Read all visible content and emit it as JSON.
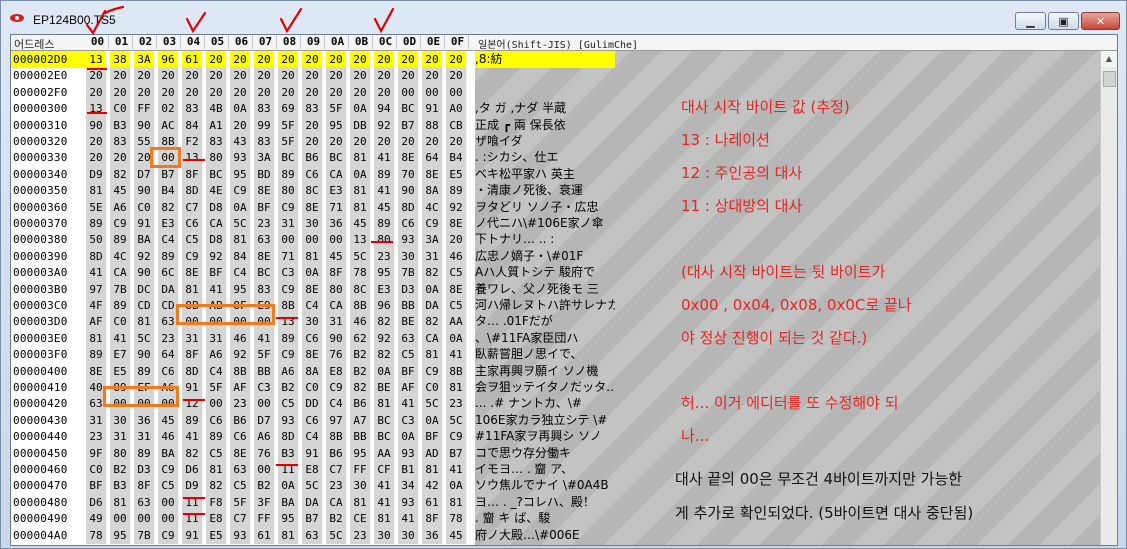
{
  "window": {
    "title": "EP124B00.TS5"
  },
  "header": {
    "offset_label": "어드레스",
    "columns": [
      "00",
      "01",
      "02",
      "03",
      "04",
      "05",
      "06",
      "07",
      "08",
      "09",
      "0A",
      "0B",
      "0C",
      "0D",
      "0E",
      "0F"
    ],
    "encoding_label": "일본어(Shift-JIS) [GulimChe]"
  },
  "rows": [
    {
      "addr": "000002D0",
      "bytes": [
        "13",
        "38",
        "3A",
        "96",
        "61",
        "20",
        "20",
        "20",
        "20",
        "20",
        "20",
        "20",
        "20",
        "20",
        "20",
        "20"
      ],
      "text": " ,8:紡",
      "highlight": true
    },
    {
      "addr": "000002E0",
      "bytes": [
        "20",
        "20",
        "20",
        "20",
        "20",
        "20",
        "20",
        "20",
        "20",
        "20",
        "20",
        "20",
        "20",
        "20",
        "20",
        "20"
      ],
      "text": ""
    },
    {
      "addr": "000002F0",
      "bytes": [
        "20",
        "20",
        "20",
        "20",
        "20",
        "20",
        "20",
        "20",
        "20",
        "20",
        "20",
        "20",
        "20",
        "00",
        "00",
        "00"
      ],
      "text": ""
    },
    {
      "addr": "00000300",
      "bytes": [
        "13",
        "C0",
        "FF",
        "02",
        "83",
        "4B",
        "0A",
        "83",
        "69",
        "83",
        "5F",
        "0A",
        "94",
        "BC",
        "91",
        "A0"
      ],
      "text": " ,タ  ガ ,ナダ 半蔵"
    },
    {
      "addr": "00000310",
      "bytes": [
        "90",
        "B3",
        "90",
        "AC",
        "84",
        "A1",
        "20",
        "99",
        "5F",
        "20",
        "95",
        "DB",
        "92",
        "B7",
        "88",
        "CB"
      ],
      "text": "正成 ┏ 兩  保長依"
    },
    {
      "addr": "00000320",
      "bytes": [
        "20",
        "83",
        "55",
        "8B",
        "F2",
        "83",
        "43",
        "83",
        "5F",
        "20",
        "20",
        "20",
        "20",
        "20",
        "20",
        "20"
      ],
      "text": "  ザ喰イダ"
    },
    {
      "addr": "00000330",
      "bytes": [
        "20",
        "20",
        "20",
        "00",
        "13",
        "80",
        "93",
        "3A",
        "BC",
        "B6",
        "BC",
        "81",
        "41",
        "8E",
        "64",
        "B4"
      ],
      "text": "      .  :シカシ、仕エ"
    },
    {
      "addr": "00000340",
      "bytes": [
        "D9",
        "82",
        "D7",
        "B7",
        "8F",
        "BC",
        "95",
        "BD",
        "89",
        "C6",
        "CA",
        "0A",
        "89",
        "70",
        "8E",
        "E5"
      ],
      "text": "   ベキ松平家ハ 英主"
    },
    {
      "addr": "00000350",
      "bytes": [
        "81",
        "45",
        "90",
        "B4",
        "8D",
        "4E",
        "C9",
        "8E",
        "80",
        "8C",
        "E3",
        "81",
        "41",
        "90",
        "8A",
        "89"
      ],
      "text": "・清康ノ死後、衰運"
    },
    {
      "addr": "00000360",
      "bytes": [
        "5E",
        "A6",
        "C0",
        "82",
        "C7",
        "D8",
        "0A",
        "BF",
        "C9",
        "8E",
        "71",
        "81",
        "45",
        "8D",
        "4C",
        "92"
      ],
      "text": "  ヲタどリ ソノ子・広忠"
    },
    {
      "addr": "00000370",
      "bytes": [
        "89",
        "C9",
        "91",
        "E3",
        "C6",
        "CA",
        "5C",
        "23",
        "31",
        "30",
        "36",
        "45",
        "89",
        "C6",
        "C9",
        "8E"
      ],
      "text": "  ノ代ニハ\\#106E家ノ傘"
    },
    {
      "addr": "00000380",
      "bytes": [
        "50",
        "89",
        "BA",
        "C4",
        "C5",
        "D8",
        "81",
        "63",
        "00",
        "00",
        "00",
        "13",
        "80",
        "93",
        "3A",
        "20"
      ],
      "text": "   下トナリ…  ..   :"
    },
    {
      "addr": "00000390",
      "bytes": [
        "8D",
        "4C",
        "92",
        "89",
        "C9",
        "92",
        "84",
        "8E",
        "71",
        "81",
        "45",
        "5C",
        "23",
        "30",
        "31",
        "46"
      ],
      "text": "広忠ノ嫡子・\\#01F"
    },
    {
      "addr": "000003A0",
      "bytes": [
        "41",
        "CA",
        "90",
        "6C",
        "8E",
        "BF",
        "C4",
        "BC",
        "C3",
        "0A",
        "8F",
        "78",
        "95",
        "7B",
        "82",
        "C5"
      ],
      "text": "Aハ人質トシテ 駿府で"
    },
    {
      "addr": "000003B0",
      "bytes": [
        "97",
        "7B",
        "DC",
        "DA",
        "81",
        "41",
        "95",
        "83",
        "C9",
        "8E",
        "80",
        "8C",
        "E3",
        "D3",
        "0A",
        "8E"
      ],
      "text": "養ワレ、父ノ死後モ 三"
    },
    {
      "addr": "000003C0",
      "bytes": [
        "4F",
        "89",
        "CD",
        "CD",
        "8B",
        "AB",
        "8F",
        "E9",
        "8B",
        "C4",
        "CA",
        "8B",
        "96",
        "BB",
        "DA",
        "C5"
      ],
      "text": "  河ハ帰レヌトハ許サレナカ"
    },
    {
      "addr": "000003D0",
      "bytes": [
        "AF",
        "C0",
        "81",
        "63",
        "00",
        "00",
        "00",
        "00",
        "13",
        "30",
        "31",
        "46",
        "82",
        "BE",
        "82",
        "AA"
      ],
      "text": "  タ…     .01Fだが"
    },
    {
      "addr": "000003E0",
      "bytes": [
        "81",
        "41",
        "5C",
        "23",
        "31",
        "31",
        "46",
        "41",
        "89",
        "C6",
        "90",
        "62",
        "92",
        "63",
        "CA",
        "0A"
      ],
      "text": "、\\#11FA家臣団ハ"
    },
    {
      "addr": "000003F0",
      "bytes": [
        "89",
        "E7",
        "90",
        "64",
        "8F",
        "A6",
        "92",
        "5F",
        "C9",
        "8E",
        "76",
        "B2",
        "82",
        "C5",
        "81",
        "41"
      ],
      "text": "臥薪嘗胆ノ思イで、"
    },
    {
      "addr": "00000400",
      "bytes": [
        "8E",
        "E5",
        "89",
        "C6",
        "8D",
        "C4",
        "8B",
        "BB",
        "A6",
        "8A",
        "E8",
        "B2",
        "0A",
        "BF",
        "C9",
        "8B"
      ],
      "text": "主家再興ヲ願イ ソノ機"
    },
    {
      "addr": "00000410",
      "bytes": [
        "40",
        "89",
        "EF",
        "A6",
        "91",
        "5F",
        "AF",
        "C3",
        "B2",
        "C0",
        "C9",
        "82",
        "BE",
        "AF",
        "C0",
        "81"
      ],
      "text": "   会ヲ狙ッテイタノだッタ…"
    },
    {
      "addr": "00000420",
      "bytes": [
        "63",
        "00",
        "00",
        "00",
        "12",
        "00",
        "23",
        "00",
        "C5",
        "DD",
        "C4",
        "B6",
        "81",
        "41",
        "5C",
        "23"
      ],
      "text": "   ... .# ナントカ、\\#"
    },
    {
      "addr": "00000430",
      "bytes": [
        "31",
        "30",
        "36",
        "45",
        "89",
        "C6",
        "B6",
        "D7",
        "93",
        "C6",
        "97",
        "A7",
        "BC",
        "C3",
        "0A",
        "5C"
      ],
      "text": "106E家カラ独立シテ \\#"
    },
    {
      "addr": "00000440",
      "bytes": [
        "23",
        "31",
        "31",
        "46",
        "41",
        "89",
        "C6",
        "A6",
        "8D",
        "C4",
        "8B",
        "BB",
        "BC",
        "0A",
        "BF",
        "C9"
      ],
      "text": "#11FA家ヲ再興シ ソノ"
    },
    {
      "addr": "00000450",
      "bytes": [
        "9F",
        "80",
        "89",
        "BA",
        "82",
        "C5",
        "8E",
        "76",
        "B3",
        "91",
        "B6",
        "95",
        "AA",
        "93",
        "AD",
        "B7"
      ],
      "text": "     コで思ウ存分働キ"
    },
    {
      "addr": "00000460",
      "bytes": [
        "C0",
        "B2",
        "D3",
        "C9",
        "D6",
        "81",
        "63",
        "00",
        "11",
        "E8",
        "C7",
        "FF",
        "CF",
        "B1",
        "81",
        "41"
      ],
      "text": " イモヨ…   . 齏   ア、"
    },
    {
      "addr": "00000470",
      "bytes": [
        "BF",
        "B3",
        "8F",
        "C5",
        "D9",
        "82",
        "C5",
        "B2",
        "0A",
        "5C",
        "23",
        "30",
        "41",
        "34",
        "42",
        "0A"
      ],
      "text": "ソウ焦ルでナイ \\#0A4B"
    },
    {
      "addr": "00000480",
      "bytes": [
        "D6",
        "81",
        "63",
        "00",
        "11",
        "F8",
        "5F",
        "3F",
        "BA",
        "DA",
        "CA",
        "81",
        "41",
        "93",
        "61",
        "81"
      ],
      "text": "ヨ…   . _?コレハ、殿！"
    },
    {
      "addr": "00000490",
      "bytes": [
        "49",
        "00",
        "00",
        "00",
        "11",
        "E8",
        "C7",
        "FF",
        "95",
        "B7",
        "B2",
        "CE",
        "81",
        "41",
        "8F",
        "78"
      ],
      "text": "      .  齏  キ ば、駿"
    },
    {
      "addr": "000004A0",
      "bytes": [
        "78",
        "95",
        "7B",
        "C9",
        "91",
        "E5",
        "93",
        "61",
        "81",
        "63",
        "5C",
        "23",
        "30",
        "30",
        "36",
        "45"
      ],
      "text": "  府ノ大殿…\\#006E"
    }
  ],
  "notes": {
    "line1": "대사 시작 바이트 값 (추정)",
    "line2": "13 : 나레이션",
    "line3": "12 : 주인공의 대사",
    "line4": "11 : 상대방의 대사",
    "line5": "(대사 시작 바이트는 뒷 바이트가",
    "line6": "0x00 , 0x04, 0x08, 0x0C로 끝나",
    "line7": "야 정상 진행이 되는 것 같다.)",
    "line8": "허... 이거 에디터를 또 수정해야 되",
    "line9": "나...",
    "line10": "대사 끝의 00은 무조건 4바이트까지만 가능한",
    "line11": "게 추가로 확인되었다. (5바이트면 대사 중단됨)"
  },
  "colors": {
    "highlight": "#ffff00",
    "annotation_red": "#e52620",
    "box_orange": "#f07a1e",
    "byte_bg": "#d5d5d5"
  },
  "icons": {
    "app": "red-eye-logo-icon",
    "minimize": "minimize-icon",
    "maximize": "maximize-icon",
    "close": "close-icon"
  }
}
